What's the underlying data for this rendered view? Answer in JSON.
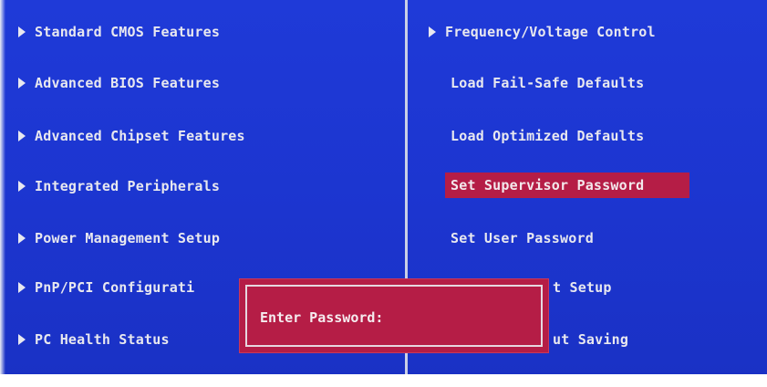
{
  "left_menu": [
    {
      "label": "Standard CMOS Features"
    },
    {
      "label": "Advanced BIOS Features"
    },
    {
      "label": "Advanced Chipset Features"
    },
    {
      "label": "Integrated Peripherals"
    },
    {
      "label": "Power Management Setup"
    },
    {
      "label": "PnP/PCI Configurati"
    },
    {
      "label": "PC Health Status"
    }
  ],
  "right_menu": [
    {
      "label": "Frequency/Voltage Control"
    },
    {
      "label": "Load Fail-Safe Defaults"
    },
    {
      "label": "Load Optimized Defaults"
    },
    {
      "label": "Set Supervisor Password"
    },
    {
      "label": "Set User Password"
    },
    {
      "label": "t Setup"
    },
    {
      "label": "ut Saving"
    }
  ],
  "dialog": {
    "label": "Enter Password:",
    "value": ""
  },
  "colors": {
    "background": "#1d36d2",
    "highlight": "#b51d46",
    "text": "#e8e8ef"
  }
}
